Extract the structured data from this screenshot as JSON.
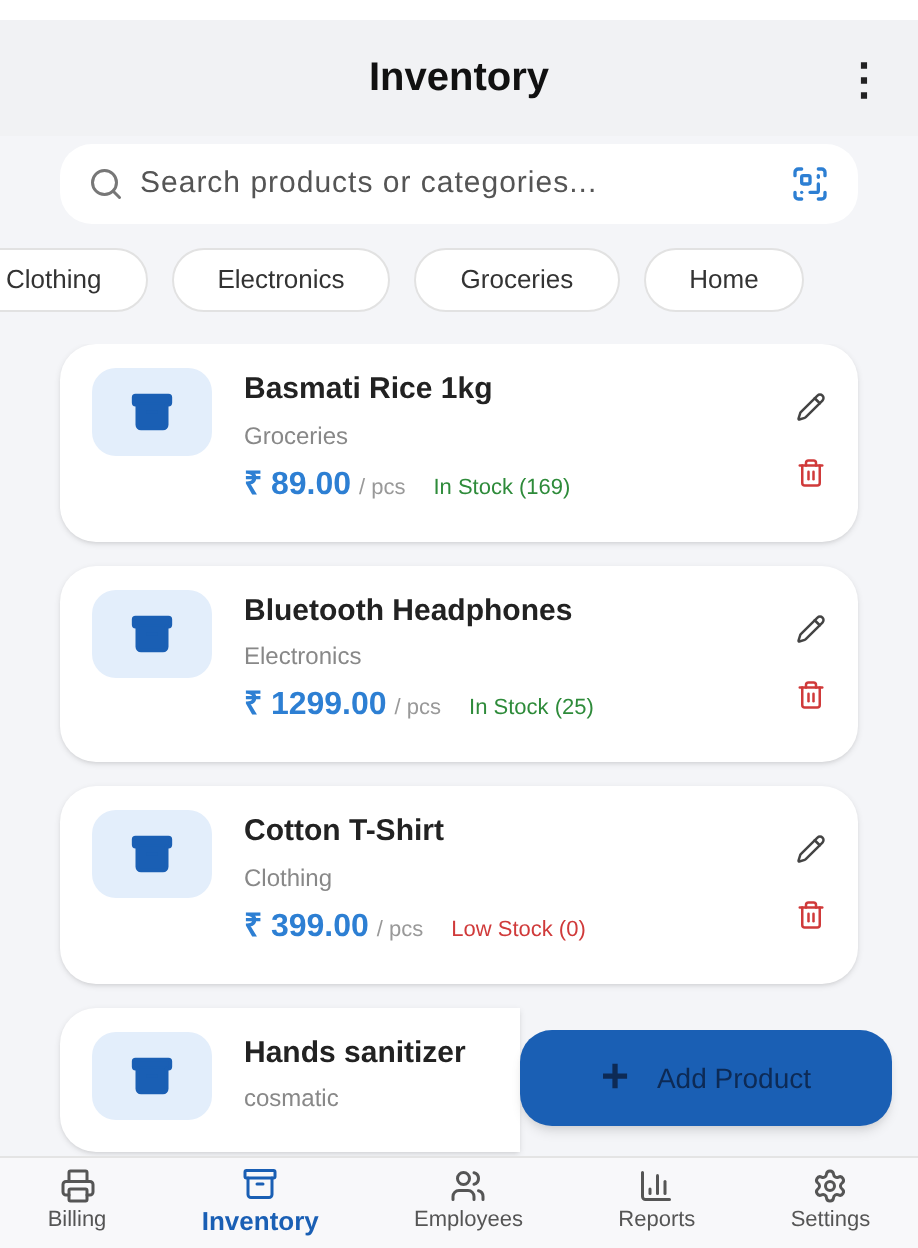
{
  "header": {
    "title": "Inventory",
    "menu": "⋮"
  },
  "search": {
    "placeholder": "Search products or categories..."
  },
  "chips": [
    {
      "label": "Clothing",
      "selected": false
    },
    {
      "label": "Electronics",
      "selected": false
    },
    {
      "label": "Groceries",
      "selected": false
    },
    {
      "label": "Home",
      "selected": false
    }
  ],
  "products": [
    {
      "name": "Basmati Rice 1kg",
      "category": "Groceries",
      "price": "₹ 89.00",
      "unit": "/ pcs",
      "stock": "In Stock (169)",
      "kind": "in"
    },
    {
      "name": "Bluetooth Headphones",
      "category": "Electronics",
      "price": "₹ 1299.00",
      "unit": "/ pcs",
      "stock": "In Stock (25)",
      "kind": "in"
    },
    {
      "name": "Cotton T-Shirt",
      "category": "Clothing",
      "price": "₹ 399.00",
      "unit": "/ pcs",
      "stock": "Low Stock (0)",
      "kind": "low"
    },
    {
      "name": "Hands sanitizer",
      "category": "cosmatic"
    }
  ],
  "fab": {
    "label": "Add Product",
    "icon": "+"
  },
  "nav": [
    {
      "label": "Billing",
      "selected": false
    },
    {
      "label": "Inventory",
      "selected": true
    },
    {
      "label": "Employees",
      "selected": false
    },
    {
      "label": "Reports",
      "selected": false
    },
    {
      "label": "Settings",
      "selected": false
    }
  ]
}
